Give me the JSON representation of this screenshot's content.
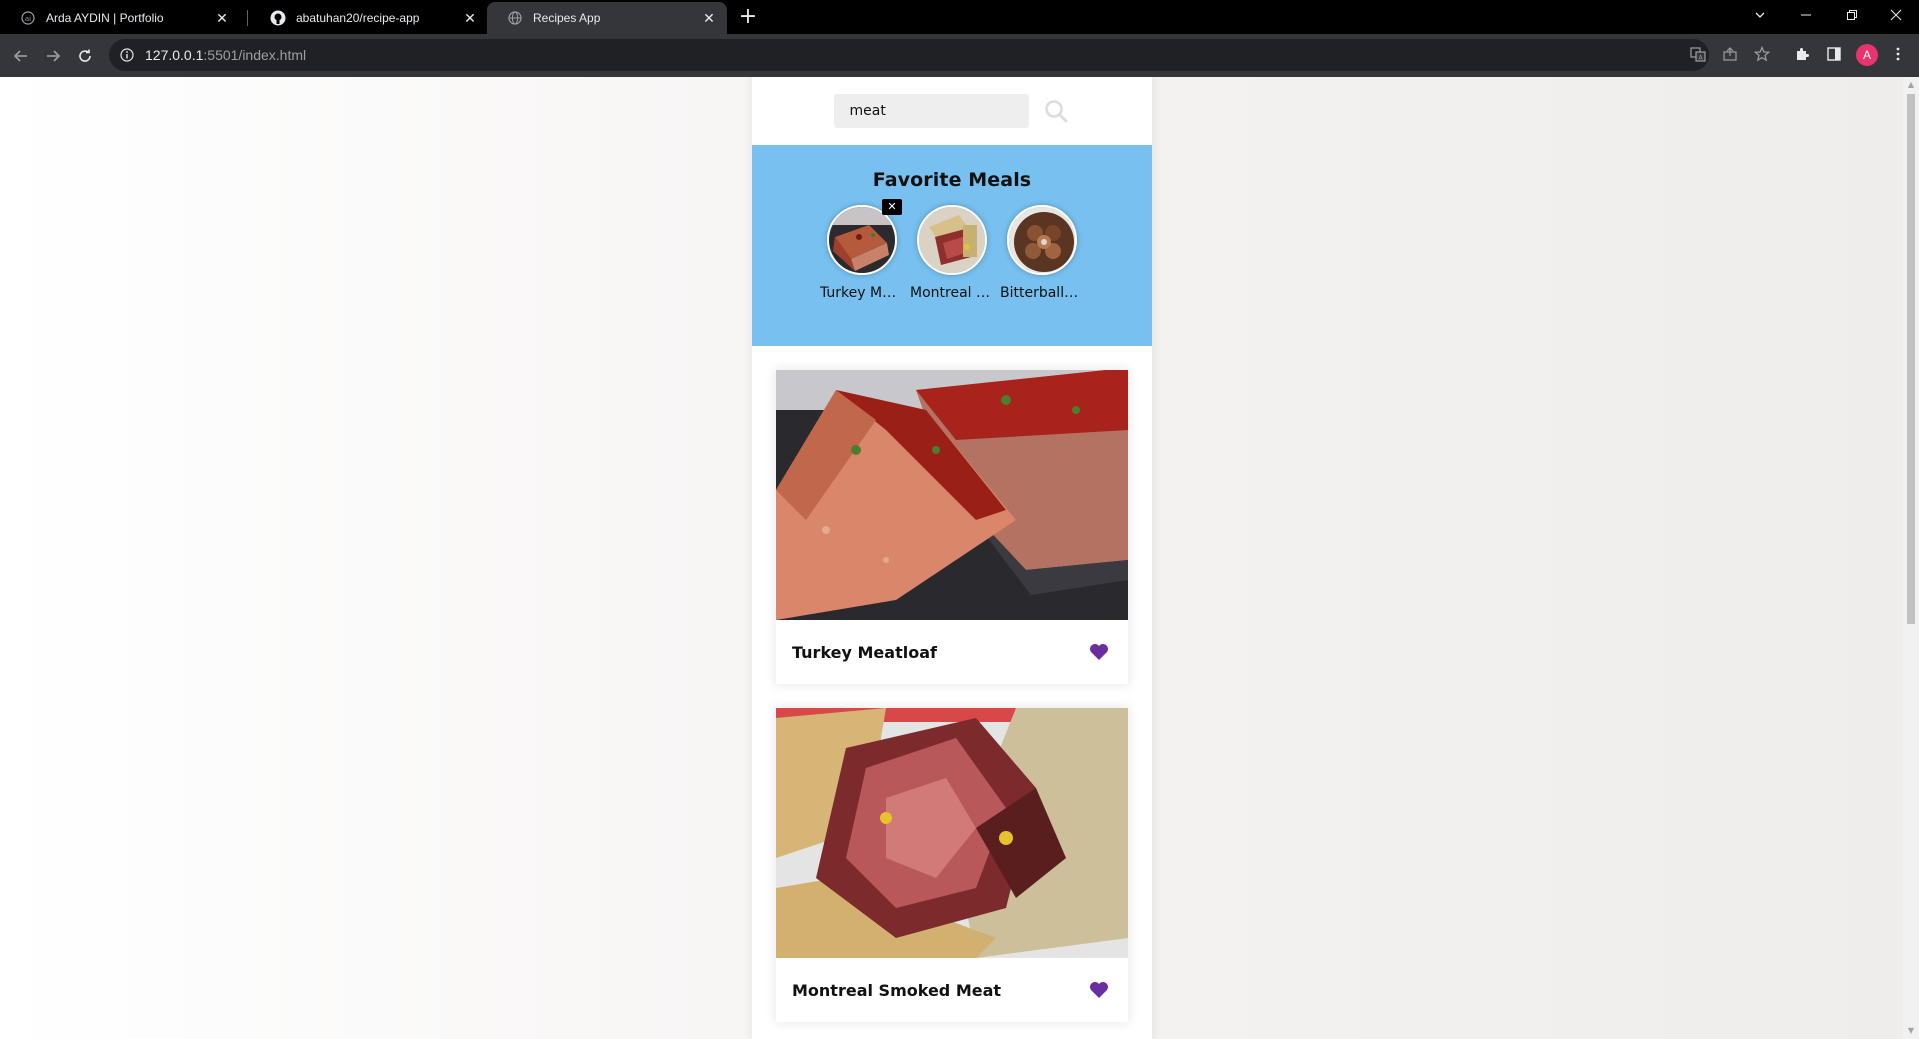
{
  "browser": {
    "tabs": [
      {
        "title": "Arda AYDIN | Portfolio"
      },
      {
        "title": "abatuhan20/recipe-app"
      },
      {
        "title": "Recipes App"
      }
    ],
    "url_host": "127.0.0.1",
    "url_rest": ":5501/index.html",
    "profile_initial": "A"
  },
  "search": {
    "value": "meat",
    "placeholder": ""
  },
  "favorites": {
    "title": "Favorite Meals",
    "items": [
      {
        "name": "Turkey Meatloaf"
      },
      {
        "name": "Montreal Smoked Meat"
      },
      {
        "name": "Bitterballen (Dutch meatballs)"
      }
    ]
  },
  "meals": [
    {
      "title": "Turkey Meatloaf"
    },
    {
      "title": "Montreal Smoked Meat"
    }
  ],
  "colors": {
    "favorites_bg": "#77c0ef",
    "heart": "#6b2ea0",
    "profile": "#e8336d"
  }
}
